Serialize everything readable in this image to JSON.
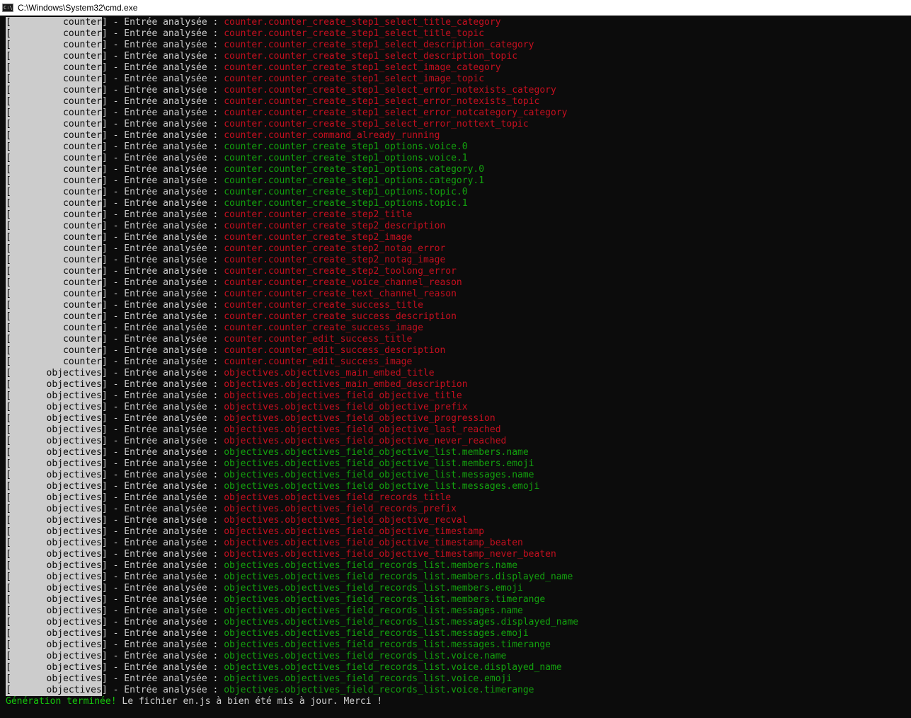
{
  "window": {
    "title": "C:\\Windows\\System32\\cmd.exe",
    "icon": "cmd-icon"
  },
  "colors": {
    "background": "#0c0c0c",
    "text": "#cccccc",
    "missing": "#c50f1f",
    "ok": "#13a10e",
    "highlight_bg": "#cccccc"
  },
  "line_template": {
    "open_bracket": "[",
    "close_bracket": "]",
    "separator": " - Entrée analysée : "
  },
  "lines": [
    {
      "module": "counter",
      "key": "counter.counter_create_step1_select_title_category",
      "status": "missing"
    },
    {
      "module": "counter",
      "key": "counter.counter_create_step1_select_title_topic",
      "status": "missing"
    },
    {
      "module": "counter",
      "key": "counter.counter_create_step1_select_description_category",
      "status": "missing"
    },
    {
      "module": "counter",
      "key": "counter.counter_create_step1_select_description_topic",
      "status": "missing"
    },
    {
      "module": "counter",
      "key": "counter.counter_create_step1_select_image_category",
      "status": "missing"
    },
    {
      "module": "counter",
      "key": "counter.counter_create_step1_select_image_topic",
      "status": "missing"
    },
    {
      "module": "counter",
      "key": "counter.counter_create_step1_select_error_notexists_category",
      "status": "missing"
    },
    {
      "module": "counter",
      "key": "counter.counter_create_step1_select_error_notexists_topic",
      "status": "missing"
    },
    {
      "module": "counter",
      "key": "counter.counter_create_step1_select_error_notcategory_category",
      "status": "missing"
    },
    {
      "module": "counter",
      "key": "counter.counter_create_step1_select_error_nottext_topic",
      "status": "missing"
    },
    {
      "module": "counter",
      "key": "counter.counter_command_already_running",
      "status": "missing"
    },
    {
      "module": "counter",
      "key": "counter.counter_create_step1_options.voice.0",
      "status": "ok"
    },
    {
      "module": "counter",
      "key": "counter.counter_create_step1_options.voice.1",
      "status": "ok"
    },
    {
      "module": "counter",
      "key": "counter.counter_create_step1_options.category.0",
      "status": "ok"
    },
    {
      "module": "counter",
      "key": "counter.counter_create_step1_options.category.1",
      "status": "ok"
    },
    {
      "module": "counter",
      "key": "counter.counter_create_step1_options.topic.0",
      "status": "ok"
    },
    {
      "module": "counter",
      "key": "counter.counter_create_step1_options.topic.1",
      "status": "ok"
    },
    {
      "module": "counter",
      "key": "counter.counter_create_step2_title",
      "status": "missing"
    },
    {
      "module": "counter",
      "key": "counter.counter_create_step2_description",
      "status": "missing"
    },
    {
      "module": "counter",
      "key": "counter.counter_create_step2_image",
      "status": "missing"
    },
    {
      "module": "counter",
      "key": "counter.counter_create_step2_notag_error",
      "status": "missing"
    },
    {
      "module": "counter",
      "key": "counter.counter_create_step2_notag_image",
      "status": "missing"
    },
    {
      "module": "counter",
      "key": "counter.counter_create_step2_toolong_error",
      "status": "missing"
    },
    {
      "module": "counter",
      "key": "counter.counter_create_voice_channel_reason",
      "status": "missing"
    },
    {
      "module": "counter",
      "key": "counter.counter_create_text_channel_reason",
      "status": "missing"
    },
    {
      "module": "counter",
      "key": "counter.counter_create_success_title",
      "status": "missing"
    },
    {
      "module": "counter",
      "key": "counter.counter_create_success_description",
      "status": "missing"
    },
    {
      "module": "counter",
      "key": "counter.counter_create_success_image",
      "status": "missing"
    },
    {
      "module": "counter",
      "key": "counter.counter_edit_success_title",
      "status": "missing"
    },
    {
      "module": "counter",
      "key": "counter.counter_edit_success_description",
      "status": "missing"
    },
    {
      "module": "counter",
      "key": "counter.counter_edit_success_image",
      "status": "missing"
    },
    {
      "module": "objectives",
      "key": "objectives.objectives_main_embed_title",
      "status": "missing"
    },
    {
      "module": "objectives",
      "key": "objectives.objectives_main_embed_description",
      "status": "missing"
    },
    {
      "module": "objectives",
      "key": "objectives.objectives_field_objective_title",
      "status": "missing"
    },
    {
      "module": "objectives",
      "key": "objectives.objectives_field_objective_prefix",
      "status": "missing"
    },
    {
      "module": "objectives",
      "key": "objectives.objectives_field_objective_progression",
      "status": "missing"
    },
    {
      "module": "objectives",
      "key": "objectives.objectives_field_objective_last_reached",
      "status": "missing"
    },
    {
      "module": "objectives",
      "key": "objectives.objectives_field_objective_never_reached",
      "status": "missing"
    },
    {
      "module": "objectives",
      "key": "objectives.objectives_field_objective_list.members.name",
      "status": "ok"
    },
    {
      "module": "objectives",
      "key": "objectives.objectives_field_objective_list.members.emoji",
      "status": "ok"
    },
    {
      "module": "objectives",
      "key": "objectives.objectives_field_objective_list.messages.name",
      "status": "ok"
    },
    {
      "module": "objectives",
      "key": "objectives.objectives_field_objective_list.messages.emoji",
      "status": "ok"
    },
    {
      "module": "objectives",
      "key": "objectives.objectives_field_records_title",
      "status": "missing"
    },
    {
      "module": "objectives",
      "key": "objectives.objectives_field_records_prefix",
      "status": "missing"
    },
    {
      "module": "objectives",
      "key": "objectives.objectives_field_objective_recval",
      "status": "missing"
    },
    {
      "module": "objectives",
      "key": "objectives.objectives_field_objective_timestamp",
      "status": "missing"
    },
    {
      "module": "objectives",
      "key": "objectives.objectives_field_objective_timestamp_beaten",
      "status": "missing"
    },
    {
      "module": "objectives",
      "key": "objectives.objectives_field_objective_timestamp_never_beaten",
      "status": "missing"
    },
    {
      "module": "objectives",
      "key": "objectives.objectives_field_records_list.members.name",
      "status": "ok"
    },
    {
      "module": "objectives",
      "key": "objectives.objectives_field_records_list.members.displayed_name",
      "status": "ok"
    },
    {
      "module": "objectives",
      "key": "objectives.objectives_field_records_list.members.emoji",
      "status": "ok"
    },
    {
      "module": "objectives",
      "key": "objectives.objectives_field_records_list.members.timerange",
      "status": "ok"
    },
    {
      "module": "objectives",
      "key": "objectives.objectives_field_records_list.messages.name",
      "status": "ok"
    },
    {
      "module": "objectives",
      "key": "objectives.objectives_field_records_list.messages.displayed_name",
      "status": "ok"
    },
    {
      "module": "objectives",
      "key": "objectives.objectives_field_records_list.messages.emoji",
      "status": "ok"
    },
    {
      "module": "objectives",
      "key": "objectives.objectives_field_records_list.messages.timerange",
      "status": "ok"
    },
    {
      "module": "objectives",
      "key": "objectives.objectives_field_records_list.voice.name",
      "status": "ok"
    },
    {
      "module": "objectives",
      "key": "objectives.objectives_field_records_list.voice.displayed_name",
      "status": "ok"
    },
    {
      "module": "objectives",
      "key": "objectives.objectives_field_records_list.voice.emoji",
      "status": "ok"
    },
    {
      "module": "objectives",
      "key": "objectives.objectives_field_records_list.voice.timerange",
      "status": "ok"
    }
  ],
  "footer": {
    "success": "Génération terminée!",
    "message": " Le fichier en.js à bien été mis à jour. Merci !"
  }
}
